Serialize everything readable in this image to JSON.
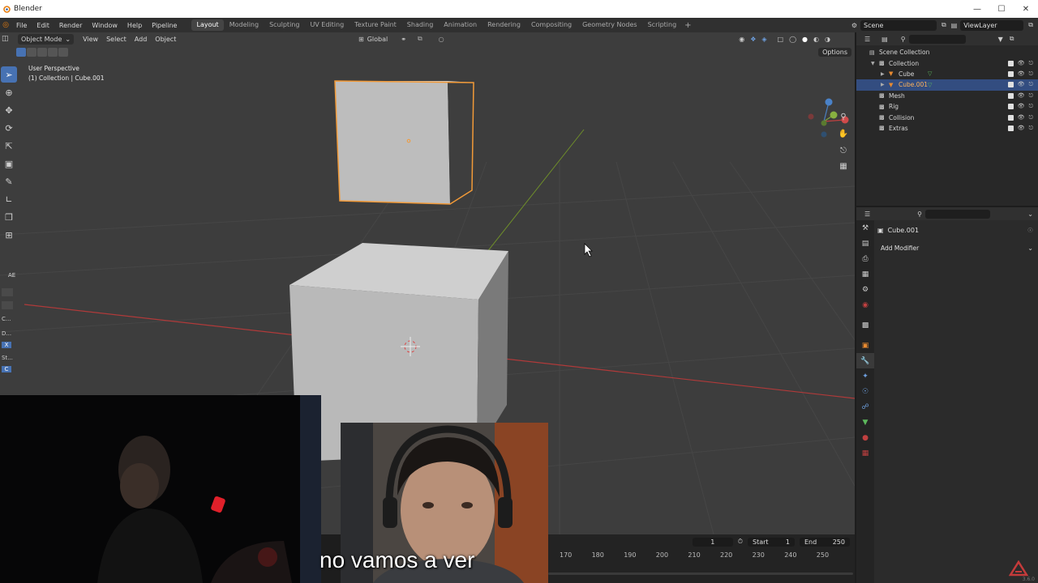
{
  "window": {
    "title": "Blender"
  },
  "menu": [
    "File",
    "Edit",
    "Render",
    "Window",
    "Help",
    "Pipeline"
  ],
  "workspaces": [
    {
      "label": "Layout",
      "active": true
    },
    {
      "label": "Modeling",
      "active": false
    },
    {
      "label": "Sculpting",
      "active": false
    },
    {
      "label": "UV Editing",
      "active": false
    },
    {
      "label": "Texture Paint",
      "active": false
    },
    {
      "label": "Shading",
      "active": false
    },
    {
      "label": "Animation",
      "active": false
    },
    {
      "label": "Rendering",
      "active": false
    },
    {
      "label": "Compositing",
      "active": false
    },
    {
      "label": "Geometry Nodes",
      "active": false
    },
    {
      "label": "Scripting",
      "active": false
    }
  ],
  "scene": {
    "name": "Scene",
    "view_layer": "ViewLayer"
  },
  "viewport": {
    "mode": "Object Mode",
    "menus": [
      "View",
      "Select",
      "Add",
      "Object"
    ],
    "transform_orientation": "Global",
    "perspective_label": "User Perspective",
    "collection_label": "(1) Collection | Cube.001",
    "options_label": "Options",
    "side_panel": [
      "AE",
      "C...",
      "D...",
      "X",
      "St...",
      "C"
    ]
  },
  "outliner": {
    "rows": [
      {
        "label": "Scene Collection",
        "indent": 0,
        "selected": false,
        "icon": "scene-collection-icon",
        "vis": false
      },
      {
        "label": "Collection",
        "indent": 1,
        "selected": false,
        "icon": "collection-icon",
        "vis": true
      },
      {
        "label": "Cube",
        "indent": 2,
        "selected": false,
        "icon": "mesh-object-icon",
        "vis": true
      },
      {
        "label": "Cube.001",
        "indent": 2,
        "selected": true,
        "icon": "mesh-object-icon",
        "vis": true
      },
      {
        "label": "Mesh",
        "indent": 1,
        "selected": false,
        "icon": "collection-icon",
        "vis": true
      },
      {
        "label": "Rig",
        "indent": 1,
        "selected": false,
        "icon": "collection-icon",
        "vis": true
      },
      {
        "label": "Collision",
        "indent": 1,
        "selected": false,
        "icon": "collection-icon",
        "vis": true
      },
      {
        "label": "Extras",
        "indent": 1,
        "selected": false,
        "icon": "collection-icon",
        "vis": true
      }
    ]
  },
  "properties": {
    "object_name": "Cube.001",
    "add_modifier_label": "Add Modifier"
  },
  "timeline": {
    "current_frame": "1",
    "start_label": "Start",
    "start_value": "1",
    "end_label": "End",
    "end_value": "250",
    "ruler": [
      "170",
      "180",
      "190",
      "200",
      "210",
      "220",
      "230",
      "240",
      "250"
    ]
  },
  "subtitle": "no vamos a ver",
  "version": "3.6.0",
  "colors": {
    "accent": "#4772b3",
    "selection_outline": "#f29a38",
    "x_axis": "#b03a3a",
    "y_axis": "#6f8f2a"
  }
}
